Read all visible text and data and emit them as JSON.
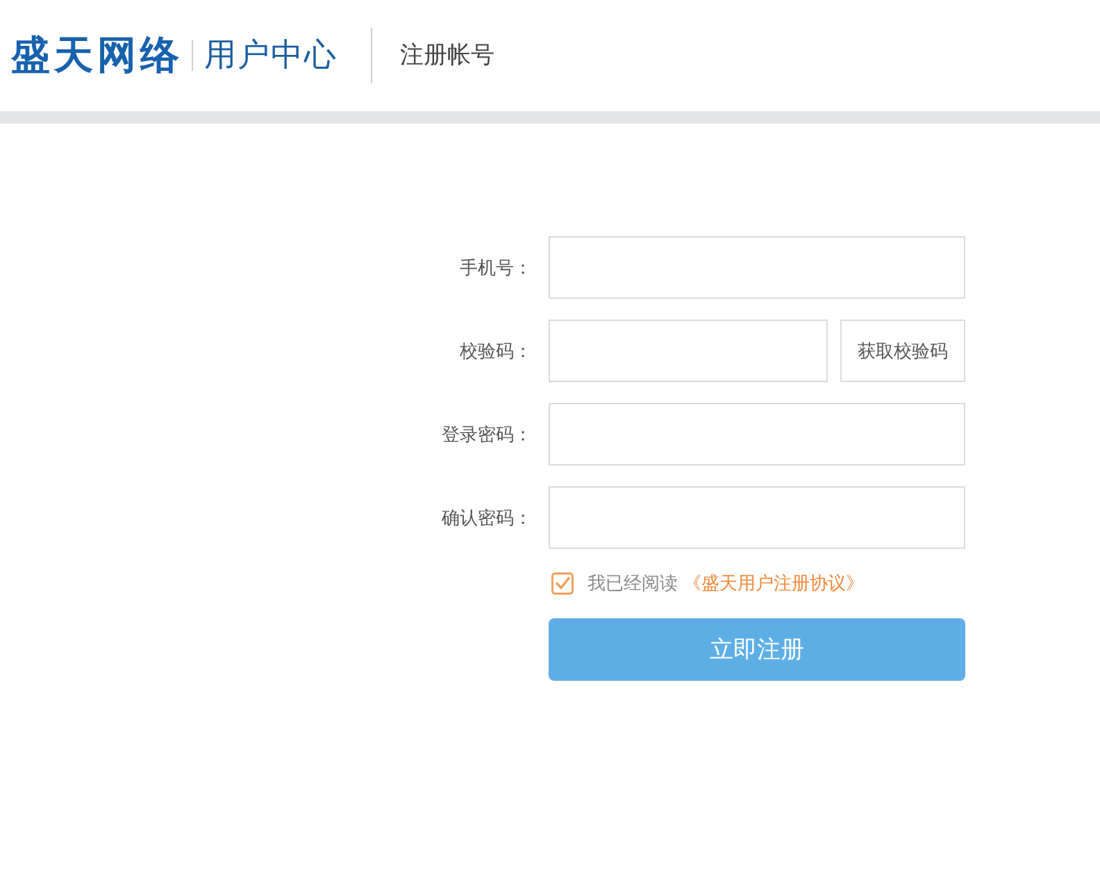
{
  "header": {
    "logo": "盛天网络",
    "subtitle": "用户中心",
    "page_title": "注册帐号"
  },
  "form": {
    "fields": [
      {
        "kind": "input",
        "label": "手机号："
      },
      {
        "kind": "code",
        "label": "校验码：",
        "button": "获取校验码"
      },
      {
        "kind": "input",
        "label": "登录密码："
      },
      {
        "kind": "input",
        "label": "确认密码："
      }
    ],
    "agreement": {
      "checked": true,
      "text": "我已经阅读",
      "link": "《盛天用户注册协议》"
    },
    "submit": "立即注册"
  }
}
